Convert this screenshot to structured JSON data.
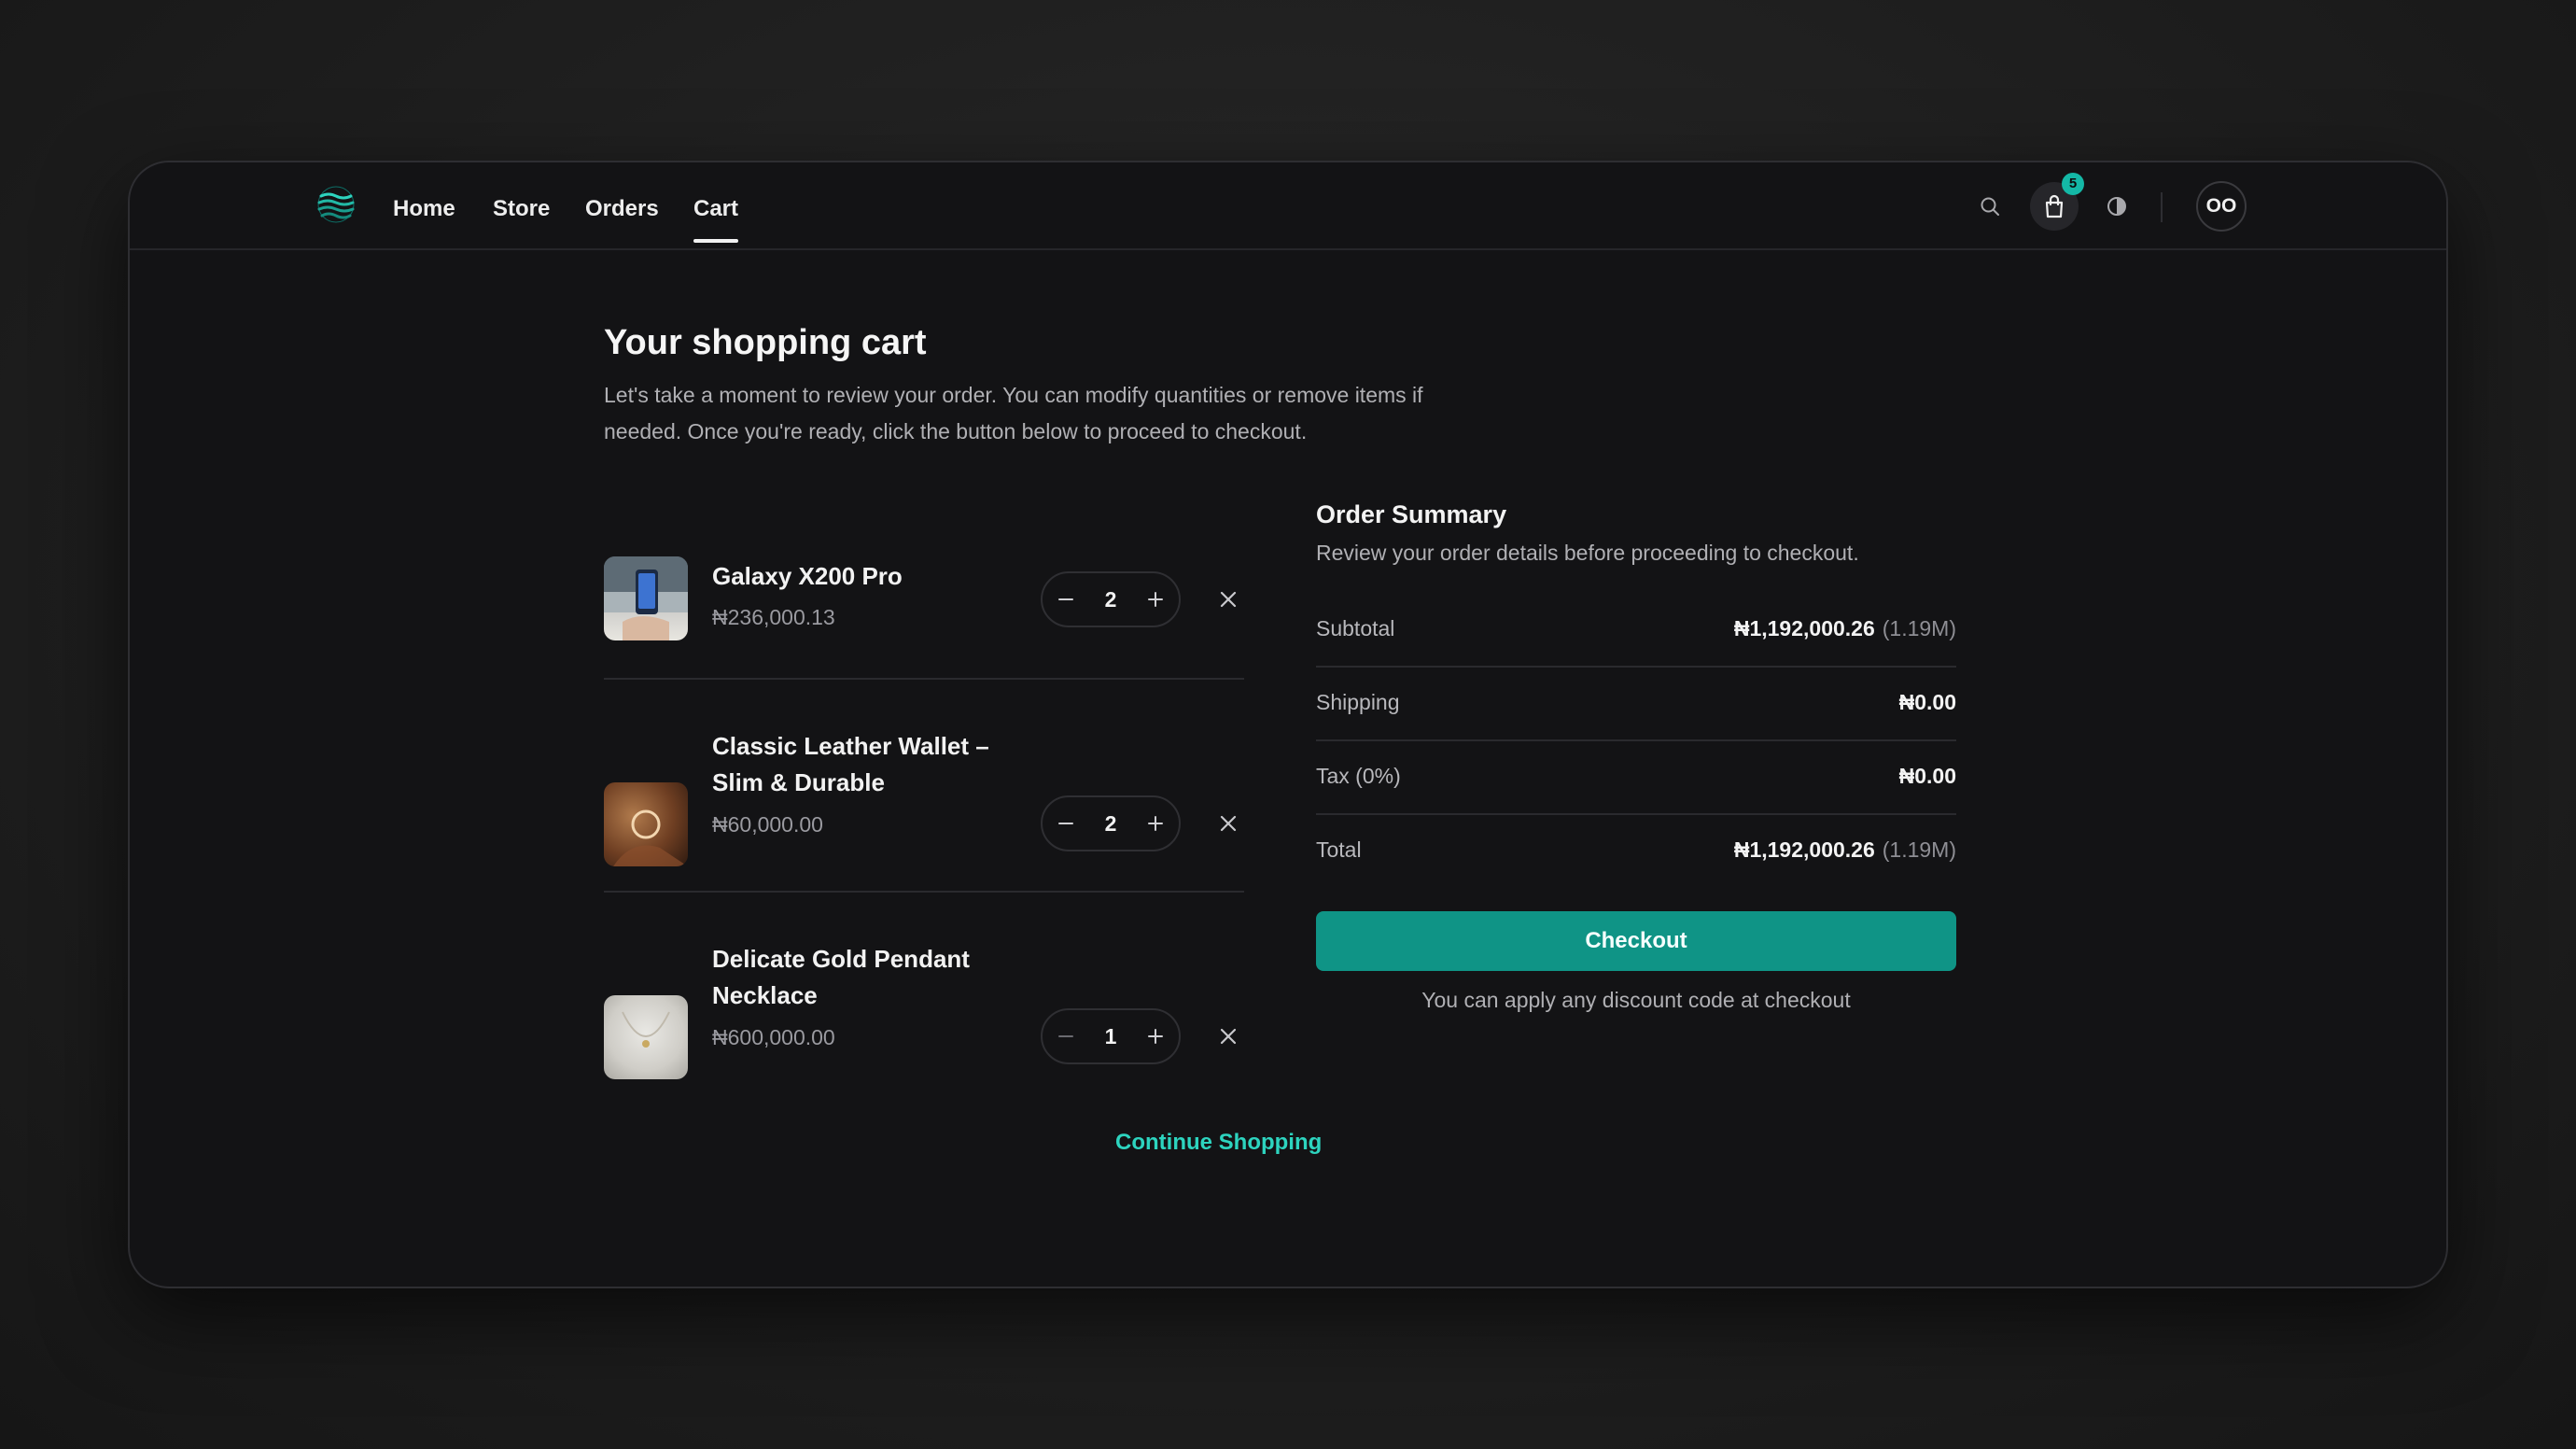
{
  "nav": {
    "links": [
      {
        "label": "Home"
      },
      {
        "label": "Store"
      },
      {
        "label": "Orders"
      },
      {
        "label": "Cart",
        "active": true
      }
    ],
    "cart_count": "5",
    "avatar_initials": "OO",
    "icons": [
      "logo-icon",
      "search-icon",
      "shopping-bag-icon",
      "theme-toggle-icon"
    ]
  },
  "page": {
    "title": "Your shopping cart",
    "description": "Let's take a moment to review your order. You can modify quantities or remove items if needed. Once you're ready, click the button below to proceed to checkout."
  },
  "cart": {
    "items": [
      {
        "name": "Galaxy X200 Pro",
        "price": "₦236,000.13",
        "quantity": "2",
        "thumbnail": "phone-photo"
      },
      {
        "name": "Classic Leather Wallet – Slim & Durable",
        "price": "₦60,000.00",
        "quantity": "2",
        "thumbnail": "leather-item-photo"
      },
      {
        "name": "Delicate Gold Pendant Necklace",
        "price": "₦600,000.00",
        "quantity": "1",
        "thumbnail": "necklace-photo"
      }
    ],
    "continue_label": "Continue Shopping"
  },
  "summary": {
    "title": "Order Summary",
    "description": "Review your order details before proceeding to checkout.",
    "rows": [
      {
        "label": "Subtotal",
        "value": "₦1,192,000.26",
        "compact": "(1.19M)"
      },
      {
        "label": "Shipping",
        "value": "₦0.00",
        "compact": ""
      },
      {
        "label": "Tax (0%)",
        "value": "₦0.00",
        "compact": ""
      },
      {
        "label": "Total",
        "value": "₦1,192,000.26",
        "compact": "(1.19M)"
      }
    ],
    "checkout_label": "Checkout",
    "note": "You can apply any discount code at checkout"
  },
  "colors": {
    "accent": "#0f9486",
    "accent_text": "#2dd4bf",
    "badge": "#14b8a6",
    "background": "#131315"
  }
}
